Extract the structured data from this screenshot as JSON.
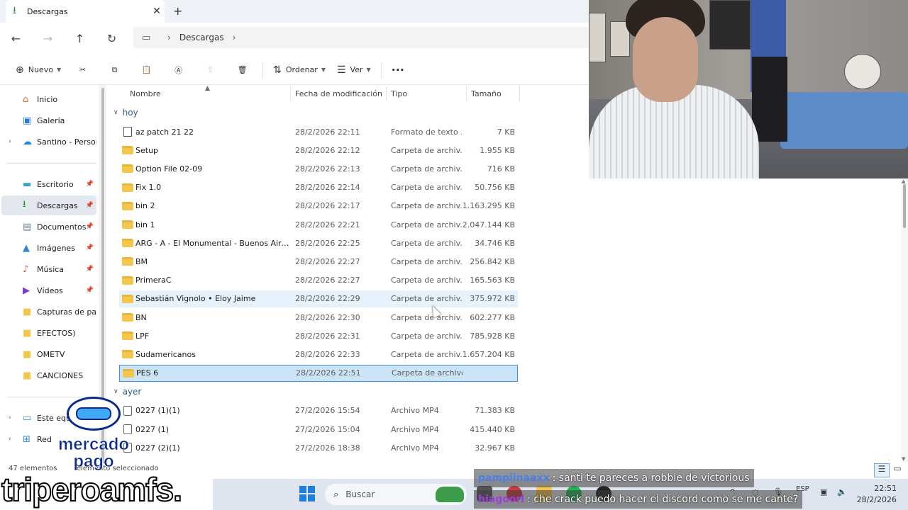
{
  "window": {
    "tab_label": "Descargas",
    "tab_close": "✕",
    "new_tab": "+"
  },
  "nav": {
    "back": "←",
    "forward": "→",
    "up": "↑",
    "refresh": "↻"
  },
  "address": {
    "crumbs": [
      "Descargas"
    ]
  },
  "command_bar": {
    "new_label": "Nuevo",
    "sort_label": "Ordenar",
    "view_label": "Ver",
    "more_label": "···"
  },
  "sidebar": {
    "items": [
      {
        "label": "Inicio",
        "icon": "home-icon",
        "color": "#e0702b"
      },
      {
        "label": "Galería",
        "icon": "gallery-icon",
        "color": "#2b79d4"
      },
      {
        "label": "Santino - Personal",
        "icon": "cloud-icon",
        "color": "#1f86d8"
      },
      {
        "label": "Escritorio",
        "icon": "desktop-icon",
        "color": "#3aa0d8"
      },
      {
        "label": "Descargas",
        "icon": "download-icon",
        "color": "#2a8a3a"
      },
      {
        "label": "Documentos",
        "icon": "documents-icon",
        "color": "#6a7f9a"
      },
      {
        "label": "Imágenes",
        "icon": "pictures-icon",
        "color": "#2f84d4"
      },
      {
        "label": "Música",
        "icon": "music-icon",
        "color": "#e05a3a"
      },
      {
        "label": "Vídeos",
        "icon": "videos-icon",
        "color": "#7a3ad0"
      },
      {
        "label": "Capturas de pantalla",
        "icon": "folder-icon",
        "color": "#f3c64c"
      },
      {
        "label": "EFECTOS)",
        "icon": "folder-icon",
        "color": "#f3c64c"
      },
      {
        "label": "OMETV",
        "icon": "folder-icon",
        "color": "#f3c64c"
      },
      {
        "label": "CANCIONES",
        "icon": "folder-icon",
        "color": "#f3c64c"
      },
      {
        "label": "Este equipo",
        "icon": "pc-icon",
        "color": "#2b8ad8"
      },
      {
        "label": "Red",
        "icon": "network-icon",
        "color": "#2b8ad8"
      }
    ]
  },
  "columns": {
    "name": "Nombre",
    "date": "Fecha de modificación",
    "type": "Tipo",
    "size": "Tamaño"
  },
  "groups": [
    {
      "label": "hoy",
      "files": [
        {
          "name": "az patch 21 22",
          "date": "28/2/2026 22:11",
          "type": "Formato de texto ...",
          "size": "7 KB",
          "kind": "doc"
        },
        {
          "name": "Setup",
          "date": "28/2/2026 22:12",
          "type": "Carpeta de archiv...",
          "size": "1.955 KB",
          "kind": "folder"
        },
        {
          "name": "Option File 02-09",
          "date": "28/2/2026 22:13",
          "type": "Carpeta de archiv...",
          "size": "716 KB",
          "kind": "folder"
        },
        {
          "name": "Fix 1.0",
          "date": "28/2/2026 22:14",
          "type": "Carpeta de archiv...",
          "size": "50.756 KB",
          "kind": "folder"
        },
        {
          "name": "bin 2",
          "date": "28/2/2026 22:17",
          "type": "Carpeta de archiv...",
          "size": "1.163.295 KB",
          "kind": "folder"
        },
        {
          "name": "bin 1",
          "date": "28/2/2026 22:21",
          "type": "Carpeta de archiv...",
          "size": "2.047.144 KB",
          "kind": "folder"
        },
        {
          "name": "ARG - A - El Monumental - Buenos Aires ...",
          "date": "28/2/2026 22:25",
          "type": "Carpeta de archiv...",
          "size": "34.746 KB",
          "kind": "folder"
        },
        {
          "name": "BM",
          "date": "28/2/2026 22:27",
          "type": "Carpeta de archiv...",
          "size": "256.842 KB",
          "kind": "folder"
        },
        {
          "name": "PrimeraC",
          "date": "28/2/2026 22:27",
          "type": "Carpeta de archiv...",
          "size": "165.563 KB",
          "kind": "folder"
        },
        {
          "name": "Sebastián Vignolo • Eloy Jaime",
          "date": "28/2/2026 22:29",
          "type": "Carpeta de archiv...",
          "size": "375.972 KB",
          "kind": "folder",
          "state": "hover"
        },
        {
          "name": "BN",
          "date": "28/2/2026 22:30",
          "type": "Carpeta de archiv...",
          "size": "602.277 KB",
          "kind": "folder"
        },
        {
          "name": "LPF",
          "date": "28/2/2026 22:31",
          "type": "Carpeta de archiv...",
          "size": "785.928 KB",
          "kind": "folder"
        },
        {
          "name": "Sudamericanos",
          "date": "28/2/2026 22:33",
          "type": "Carpeta de archiv...",
          "size": "1.657.204 KB",
          "kind": "folder"
        },
        {
          "name": "PES 6",
          "date": "28/2/2026 22:51",
          "type": "Carpeta de archivos",
          "size": "",
          "kind": "folder",
          "state": "selected"
        }
      ]
    },
    {
      "label": "ayer",
      "files": [
        {
          "name": "0227 (1)(1)",
          "date": "27/2/2026 15:54",
          "type": "Archivo MP4",
          "size": "71.383 KB",
          "kind": "mp4"
        },
        {
          "name": "0227 (1)",
          "date": "27/2/2026 15:04",
          "type": "Archivo MP4",
          "size": "415.440 KB",
          "kind": "mp4"
        },
        {
          "name": "0227 (2)(1)",
          "date": "27/2/2026 18:38",
          "type": "Archivo MP4",
          "size": "32.967 KB",
          "kind": "mp4"
        }
      ]
    }
  ],
  "status": {
    "count": "47 elementos",
    "selection": "elemento seleccionado"
  },
  "taskbar": {
    "search_placeholder": "Buscar",
    "lang": "ESP",
    "time": "22:51",
    "date": "28/2/2026"
  },
  "chat": [
    {
      "user": "pampiinaaxx",
      "user_color": "#4a7fe8",
      "message": ": santi te pareces a robbie de victorious"
    },
    {
      "user": "hiagoorl",
      "user_color": "#9a3fd8",
      "message": ": che crack puedo hacer el discord como se me cante?"
    }
  ],
  "overlay": {
    "mp_line1": "mercado",
    "mp_line2": "pago",
    "channel": "triperoamfs."
  },
  "colors": {
    "accent": "#3d8ee0",
    "selected_row": "#cce4f7",
    "hover_row": "#e5f1fb",
    "folder": "#f3c64c"
  }
}
